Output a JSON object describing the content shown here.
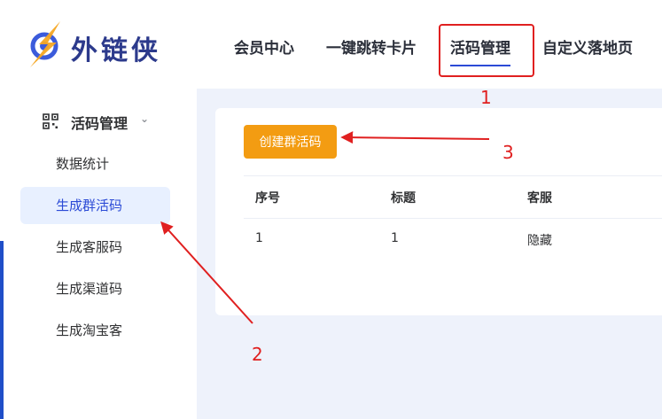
{
  "brand": {
    "name": "外链侠",
    "accent": "#2b4ad6",
    "logo_icon": "compass-bolt-icon"
  },
  "nav": {
    "items": [
      {
        "label": "会员中心"
      },
      {
        "label": "一键跳转卡片"
      },
      {
        "label": "活码管理",
        "active": true
      },
      {
        "label": "自定义落地页"
      }
    ]
  },
  "sidebar": {
    "section": {
      "label": "活码管理",
      "icon": "qrcode-icon",
      "chevron": "chevron-down-icon"
    },
    "items": [
      {
        "label": "数据统计"
      },
      {
        "label": "生成群活码",
        "active": true
      },
      {
        "label": "生成客服码"
      },
      {
        "label": "生成渠道码"
      },
      {
        "label": "生成淘宝客"
      }
    ]
  },
  "main": {
    "create_button": "创建群活码",
    "table": {
      "headers": [
        "序号",
        "标题",
        "客服"
      ],
      "rows": [
        [
          "1",
          "1",
          "隐藏"
        ]
      ]
    }
  },
  "annotations": {
    "color": "#e02020",
    "labels": [
      "1",
      "2",
      "3"
    ]
  }
}
